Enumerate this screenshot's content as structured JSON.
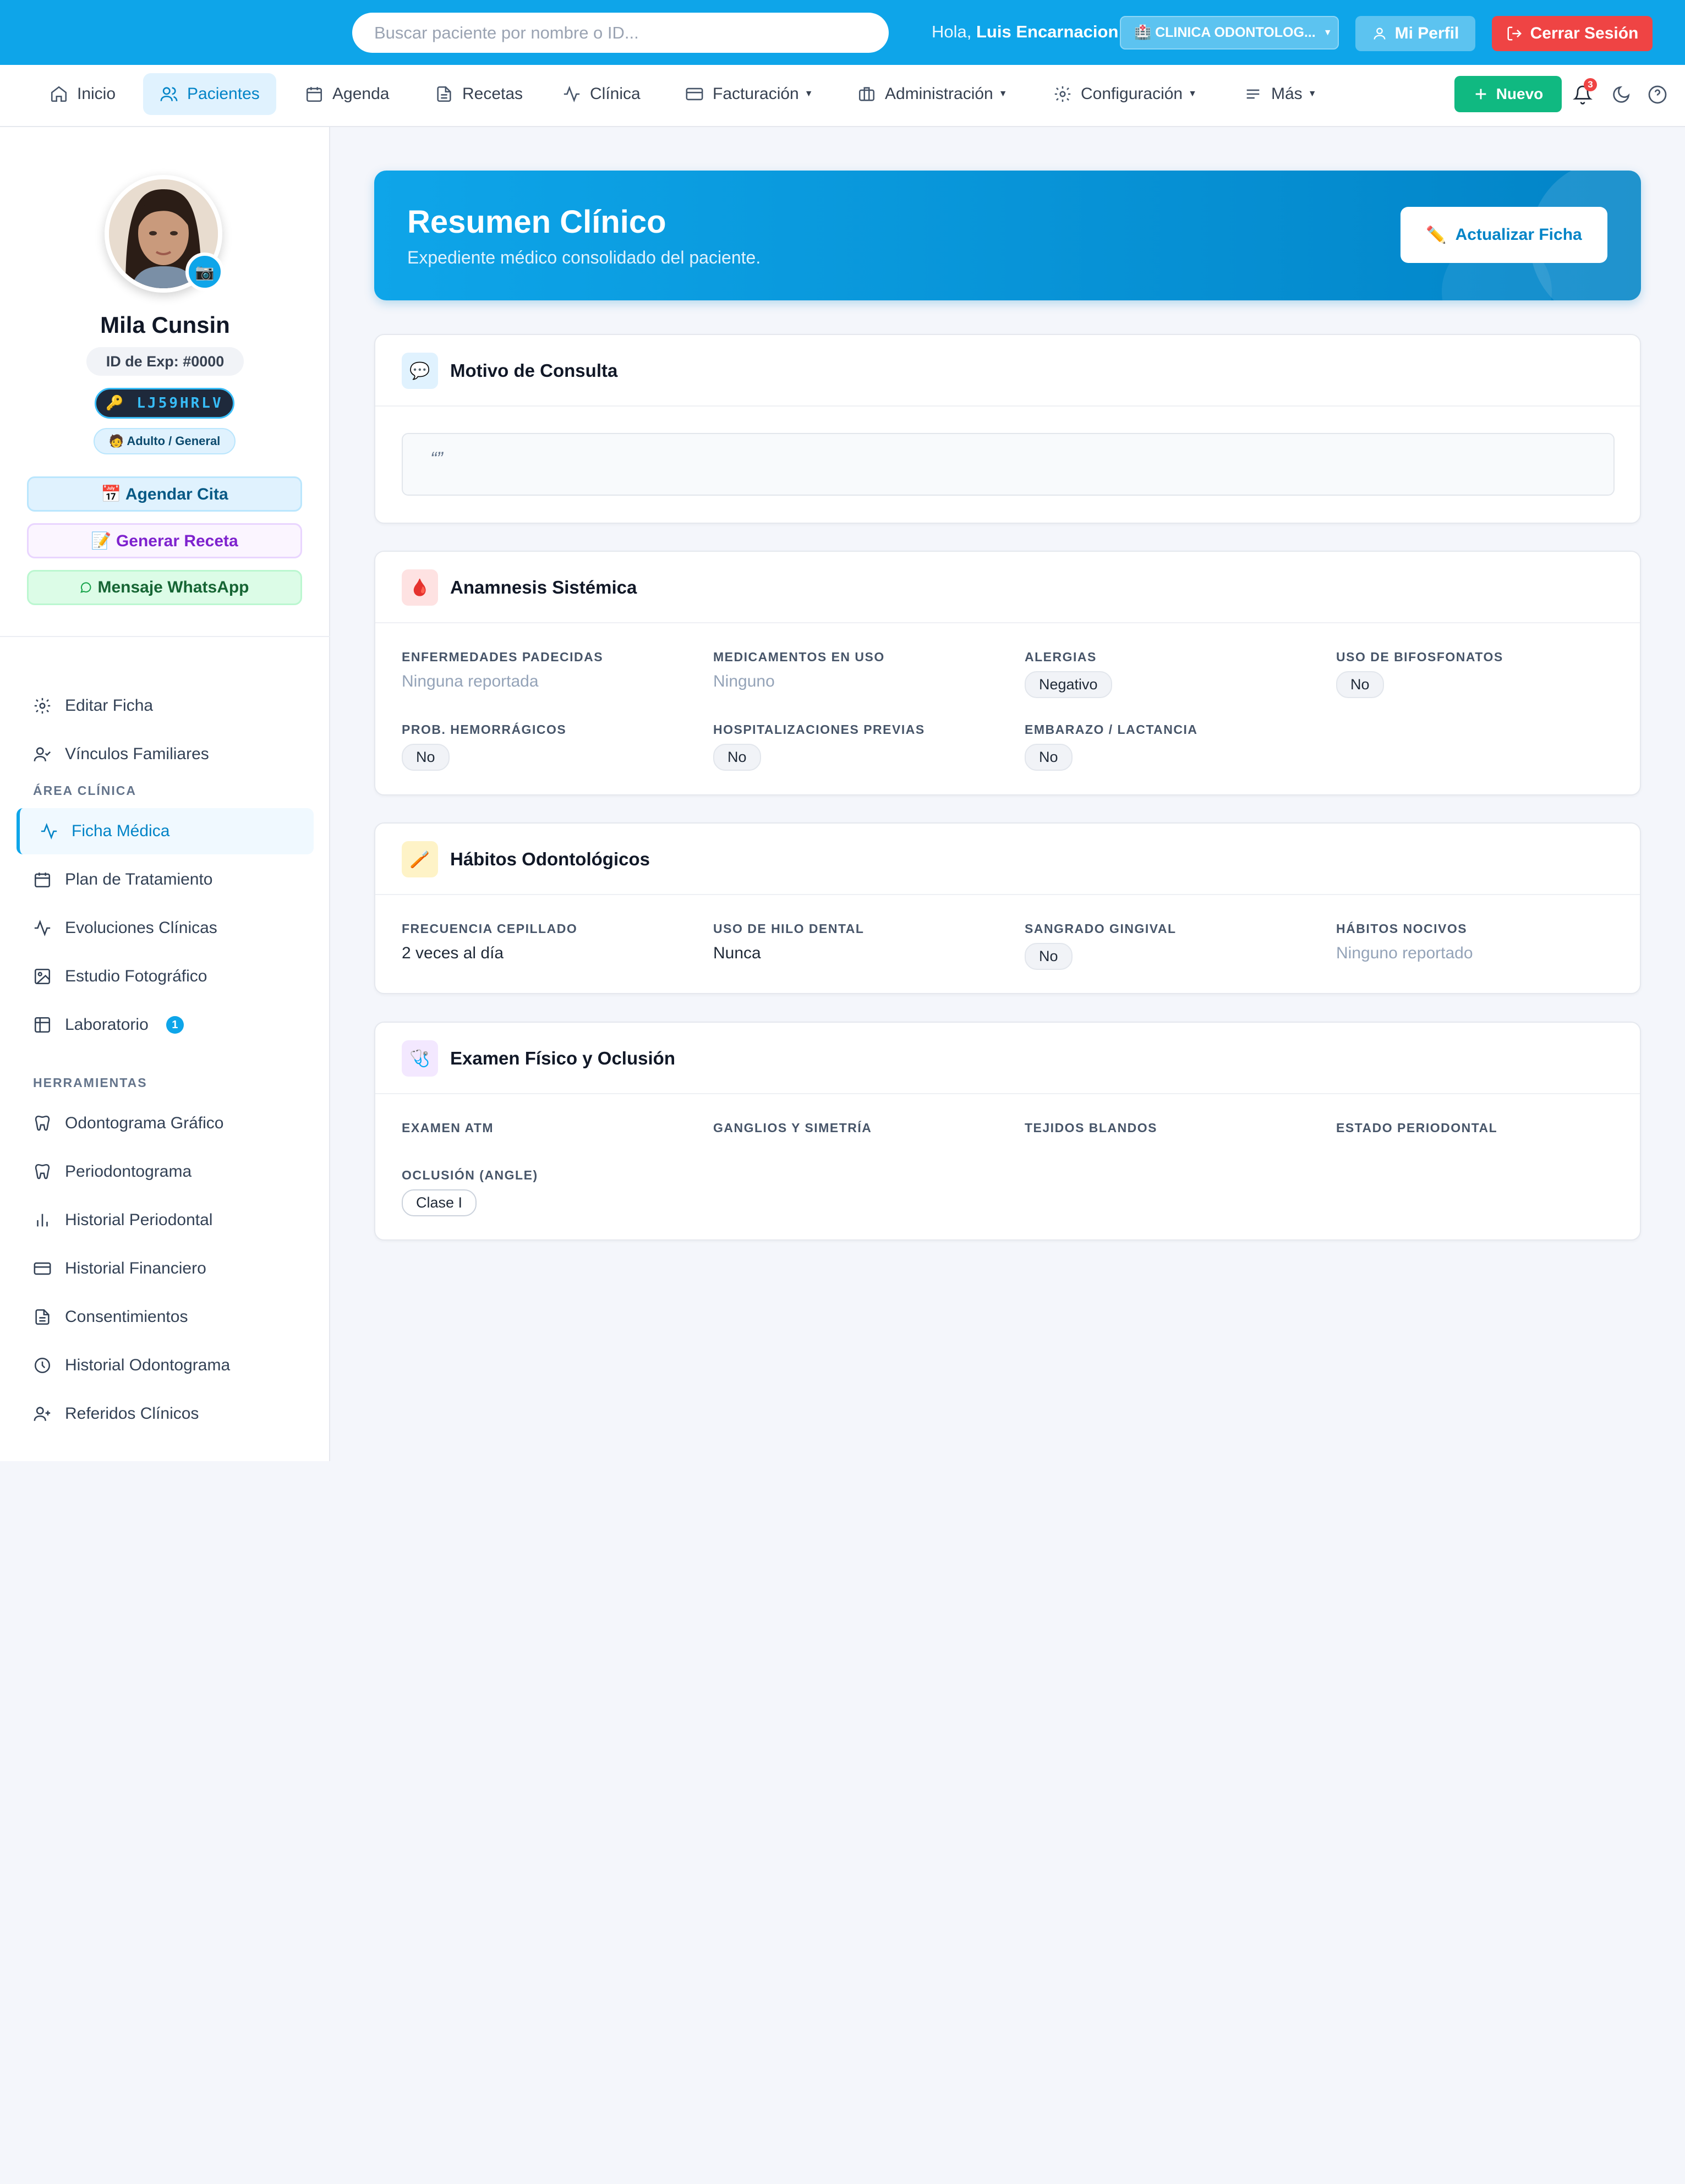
{
  "topbar": {
    "search_placeholder": "Buscar paciente por nombre o ID...",
    "greeting": "Hola,",
    "user_name": "Luis Encarnacion",
    "clinic_label": "🏥 CLINICA ODONTOLOG...",
    "profile_label": "Mi Perfil",
    "logout_label": "Cerrar Sesión"
  },
  "nav": {
    "items": [
      {
        "label": "Inicio",
        "icon": "home-icon"
      },
      {
        "label": "Pacientes",
        "icon": "users-icon",
        "active": true
      },
      {
        "label": "Agenda",
        "icon": "calendar-icon"
      },
      {
        "label": "Recetas",
        "icon": "document-icon"
      },
      {
        "label": "Clínica",
        "icon": "activity-icon"
      },
      {
        "label": "Facturación",
        "icon": "credit-card-icon",
        "dropdown": true
      },
      {
        "label": "Administración",
        "icon": "briefcase-icon",
        "dropdown": true
      },
      {
        "label": "Configuración",
        "icon": "gear-icon",
        "dropdown": true
      },
      {
        "label": "Más",
        "icon": "menu-icon",
        "dropdown": true
      }
    ],
    "new_label": "Nuevo",
    "notifications_count": "3"
  },
  "patient": {
    "name": "Mila Cunsin",
    "exp_id": "ID de Exp: #0000",
    "code": "🔑 LJ59HRLV",
    "category": "🧑 Adulto / General",
    "actions": {
      "cita": "📅 Agendar Cita",
      "receta": "📝 Generar Receta",
      "whatsapp": "Mensaje WhatsApp"
    }
  },
  "sidebar": {
    "top_items": [
      {
        "label": "Editar Ficha",
        "icon": "gear-icon"
      },
      {
        "label": "Vínculos Familiares",
        "icon": "user-check-icon"
      }
    ],
    "section_clinica": "ÁREA CLÍNICA",
    "clinica_items": [
      {
        "label": "Ficha Médica",
        "icon": "activity-icon",
        "active": true
      },
      {
        "label": "Plan de Tratamiento",
        "icon": "calendar-icon"
      },
      {
        "label": "Evoluciones Clínicas",
        "icon": "activity-icon"
      },
      {
        "label": "Estudio Fotográfico",
        "icon": "image-icon"
      },
      {
        "label": "Laboratorio",
        "icon": "table-icon",
        "badge": "1"
      }
    ],
    "section_herramientas": "HERRAMIENTAS",
    "herramientas_items": [
      {
        "label": "Odontograma Gráfico",
        "icon": "tooth-icon"
      },
      {
        "label": "Periodontograma",
        "icon": "tooth-icon"
      },
      {
        "label": "Historial Periodontal",
        "icon": "bar-chart-icon"
      },
      {
        "label": "Historial Financiero",
        "icon": "credit-card-icon"
      },
      {
        "label": "Consentimientos",
        "icon": "document-icon"
      },
      {
        "label": "Historial Odontograma",
        "icon": "clock-icon"
      },
      {
        "label": "Referidos Clínicos",
        "icon": "user-plus-icon"
      }
    ]
  },
  "hero": {
    "title": "Resumen Clínico",
    "subtitle": "Expediente médico consolidado del paciente.",
    "button": "Actualizar Ficha"
  },
  "motivo": {
    "title": "Motivo de Consulta",
    "text": "“”"
  },
  "anamnesis": {
    "title": "Anamnesis Sistémica",
    "enfermedades_label": "ENFERMEDADES PADECIDAS",
    "enfermedades_value": "Ninguna reportada",
    "medicamentos_label": "MEDICAMENTOS EN USO",
    "medicamentos_value": "Ninguno",
    "alergias_label": "ALERGIAS",
    "alergias_value": "Negativo",
    "bifosfonatos_label": "USO DE BIFOSFONATOS",
    "bifosfonatos_value": "No",
    "hemorragicos_label": "PROB. HEMORRÁGICOS",
    "hemorragicos_value": "No",
    "hospitalizaciones_label": "HOSPITALIZACIONES PREVIAS",
    "hospitalizaciones_value": "No",
    "embarazo_label": "EMBARAZO / LACTANCIA",
    "embarazo_value": "No"
  },
  "habitos": {
    "title": "Hábitos Odontológicos",
    "cepillado_label": "FRECUENCIA CEPILLADO",
    "cepillado_value": "2 veces al día",
    "hilo_label": "USO DE HILO DENTAL",
    "hilo_value": "Nunca",
    "sangrado_label": "SANGRADO GINGIVAL",
    "sangrado_value": "No",
    "nocivos_label": "HÁBITOS NOCIVOS",
    "nocivos_value": "Ninguno reportado"
  },
  "examen": {
    "title": "Examen Físico y Oclusión",
    "atm_label": "EXAMEN ATM",
    "ganglios_label": "GANGLIOS Y SIMETRÍA",
    "tejidos_label": "TEJIDOS BLANDOS",
    "periodontal_label": "ESTADO PERIODONTAL",
    "oclusion_label": "OCLUSIÓN (ANGLE)",
    "oclusion_value": "Clase I"
  },
  "colors": {
    "primary": "#0ea5e9",
    "danger": "#ef4444",
    "success": "#10b981"
  }
}
